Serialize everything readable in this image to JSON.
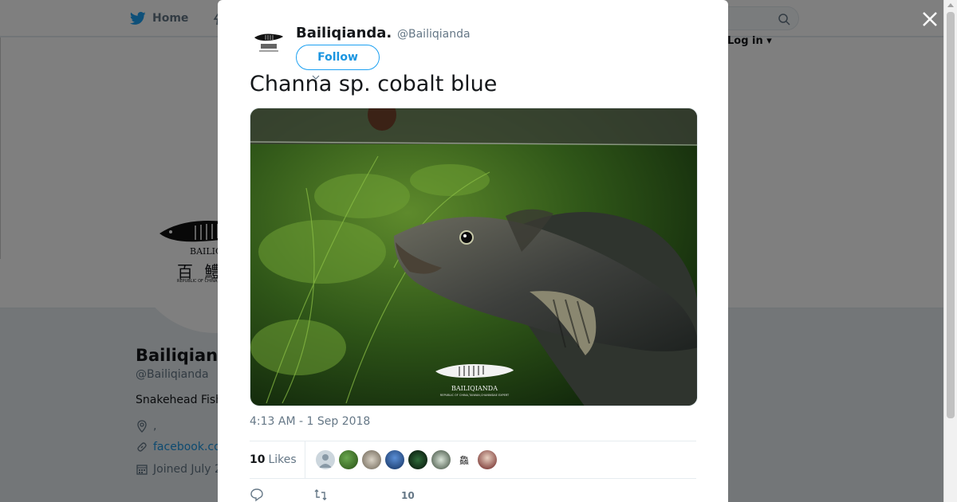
{
  "topnav": {
    "home_label": "Home",
    "login_label": "Log in"
  },
  "profile": {
    "name": "Bailiqian",
    "handle": "@Bailiqianda",
    "bio": "Snakehead Fish",
    "location": ",",
    "website": "facebook.co",
    "joined": "Joined July 2",
    "logo_text_1": "BAILIQ",
    "logo_text_2": "百 鱧",
    "logo_text_3": "REPUBLIC OF CHINA,TAIWAN"
  },
  "modal": {
    "author_name": "Bailiqianda.",
    "author_handle": "@Bailiqianda",
    "follow_label": "Follow",
    "tweet_text": "Channa sp. cobalt blue",
    "photo_watermark": "BAILIQIANDA",
    "photo_watermark_sub": "REPUBLIC OF CHINA,TAIWAN,CHANNIDAE EXPERT",
    "timestamp": "4:13 AM - 1 Sep 2018",
    "likes_count": "10",
    "likes_label": "Likes",
    "like_action_count": "10",
    "liker_glyph": "鱻"
  },
  "colors": {
    "accent": "#1da1f2",
    "link": "#1b95e0",
    "muted": "#657786"
  }
}
